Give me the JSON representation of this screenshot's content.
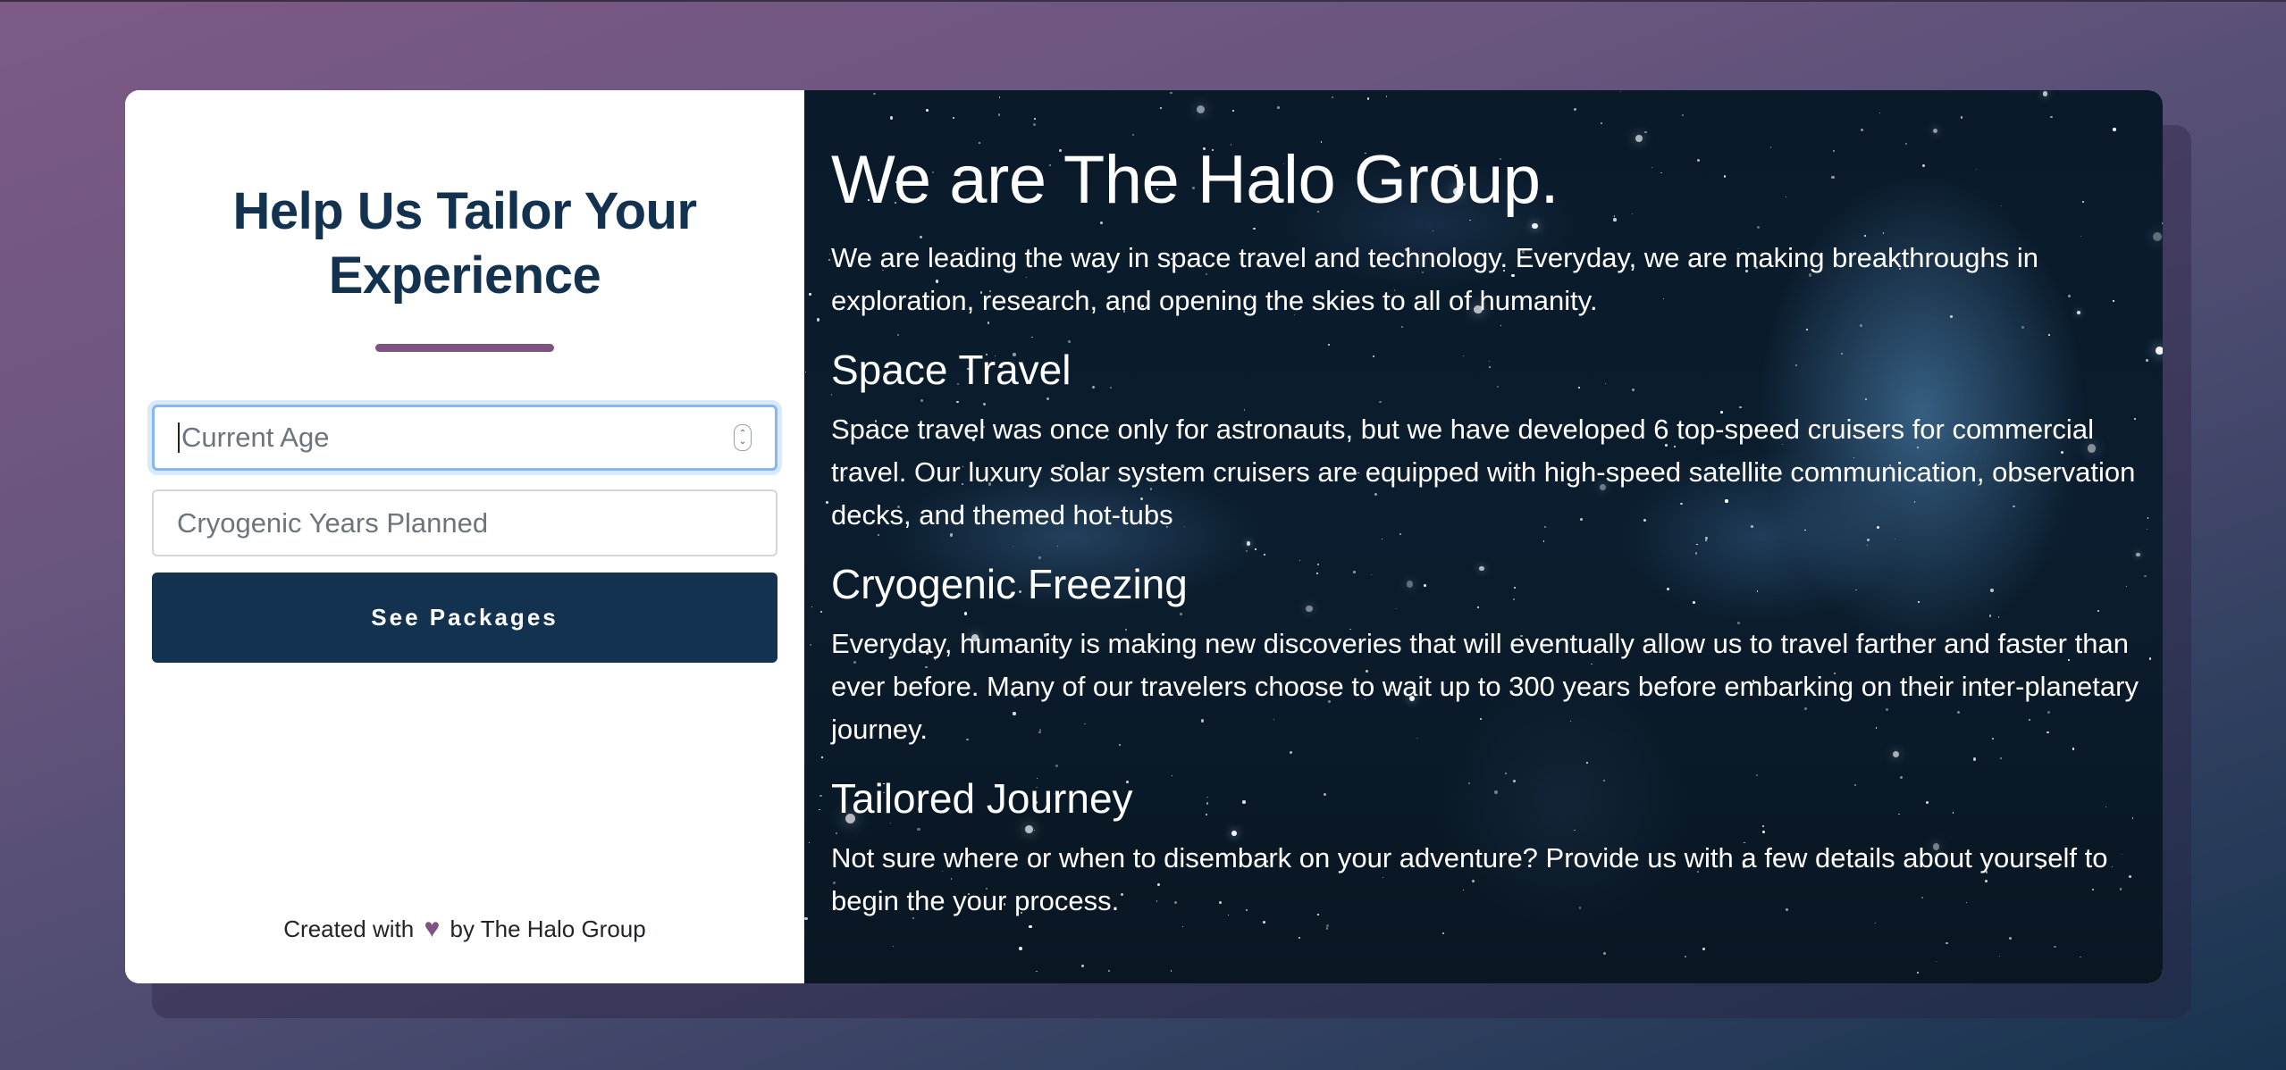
{
  "form": {
    "title_line1": "Help Us Tailor Your",
    "title_line2": "Experience",
    "age_placeholder": "Current Age",
    "cryo_placeholder": "Cryogenic Years Planned",
    "submit_label": "See Packages",
    "footer_prefix": "Created with",
    "footer_suffix": "by The Halo Group",
    "accent_color": "#7d5382",
    "primary_color": "#13324f"
  },
  "about": {
    "heading": "We are The Halo Group.",
    "intro": "We are leading the way in space travel and technology. Everyday, we are making breakthroughs in exploration, research, and opening the skies to all of humanity.",
    "sections": [
      {
        "title": "Space Travel",
        "body": "Space travel was once only for astronauts, but we have developed 6 top-speed cruisers for commercial travel. Our luxury solar system cruisers are equipped with high-speed satellite communication, observation decks, and themed hot-tubs"
      },
      {
        "title": "Cryogenic Freezing",
        "body": "Everyday, humanity is making new discoveries that will eventually allow us to travel farther and faster than ever before. Many of our travelers choose to wait up to 300 years before embarking on their inter-planetary journey."
      },
      {
        "title": "Tailored Journey",
        "body": "Not sure where or when to disembark on your adventure? Provide us with a few details about yourself to begin the your process."
      }
    ]
  }
}
